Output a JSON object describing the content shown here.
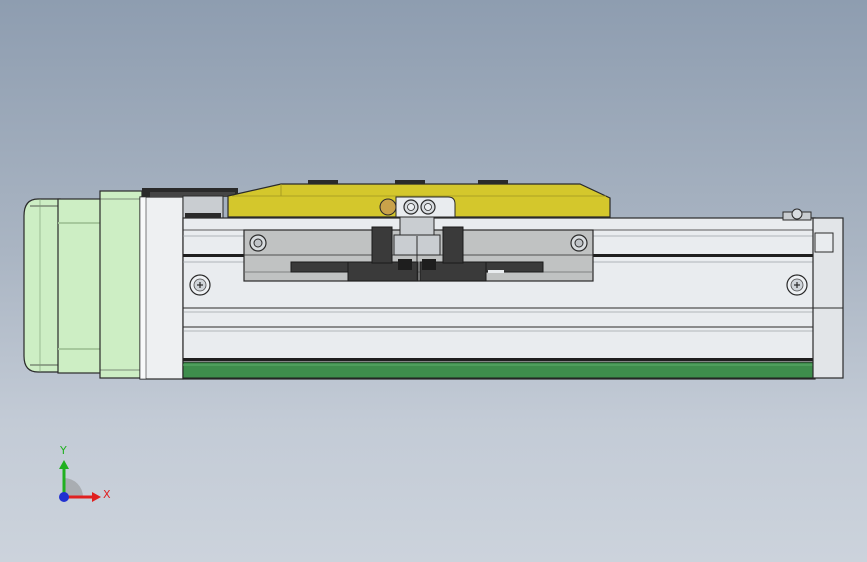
{
  "view": {
    "background_top": "#8e9db0",
    "background_bottom": "#ccd3dc"
  },
  "model": {
    "motor_color": "#cdeec4",
    "carriage_top_color": "#d4c72c",
    "rail_color": "#e9ecef",
    "strip_color": "#3e8d4c",
    "bracket_color": "#c0c2c2"
  },
  "triad": {
    "x_label": "X",
    "y_label": "Y",
    "x_color": "#e02020",
    "y_color": "#20b020",
    "z_color": "#2030d0"
  }
}
